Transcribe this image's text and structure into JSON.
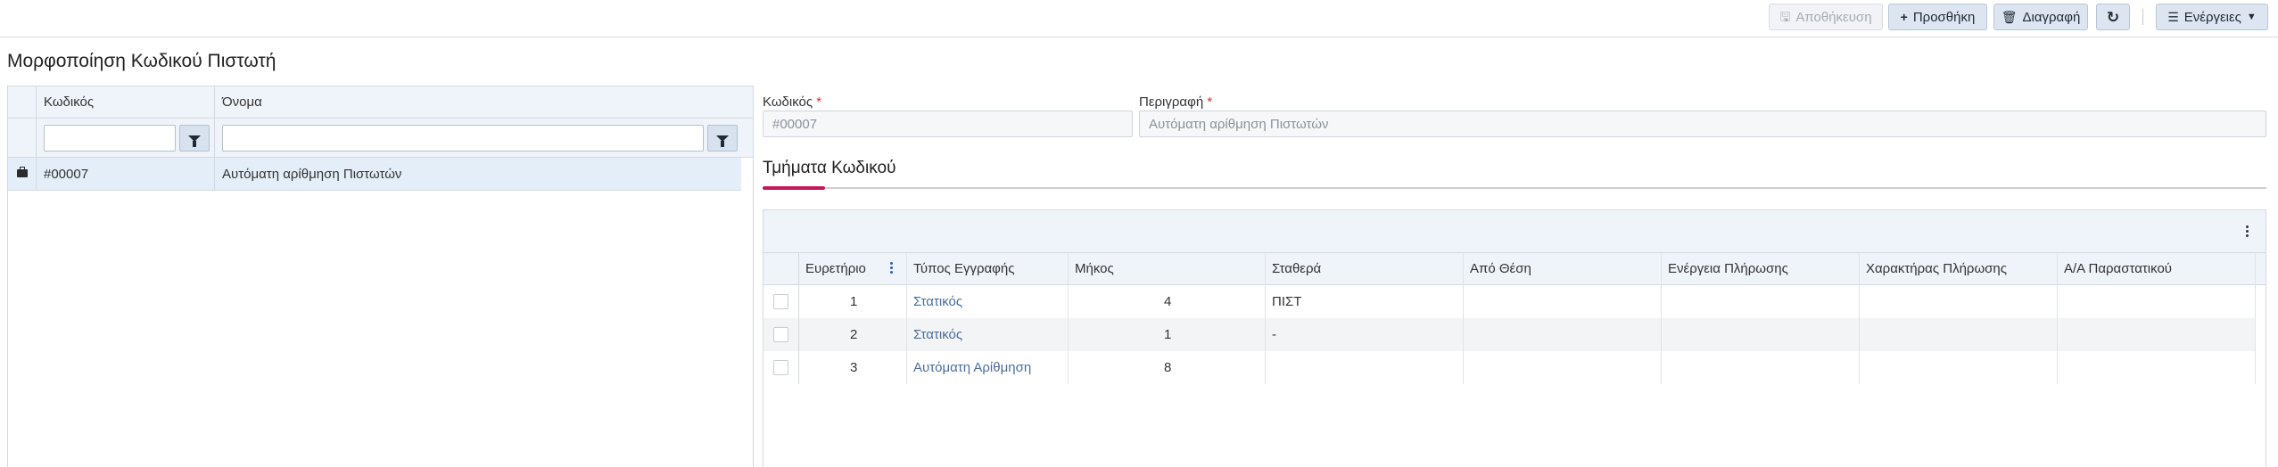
{
  "toolbar": {
    "save_label": "Αποθήκευση",
    "add_label": "Προσθήκη",
    "delete_label": "Διαγραφή",
    "actions_label": "Ενέργειες"
  },
  "page": {
    "title": "Μορφοποίηση Κωδικού Πιστωτή"
  },
  "left_grid": {
    "columns": [
      "Κωδικός",
      "Όνομα"
    ],
    "rows": [
      {
        "code": "#00007",
        "name": "Αυτόματη αρίθμηση Πιστωτών"
      }
    ]
  },
  "form": {
    "code_label": "Κωδικός",
    "code_value": "#00007",
    "description_label": "Περιγραφή",
    "description_value": "Αυτόματη αρίθμηση Πιστωτών",
    "required_mark": "*"
  },
  "section": {
    "title": "Τμήματα Κωδικού"
  },
  "segments_grid": {
    "columns": [
      "Ευρετήριο",
      "Τύπος Εγγραφής",
      "Μήκος",
      "Σταθερά",
      "Από Θέση",
      "Ενέργεια Πλήρωσης",
      "Χαρακτήρας Πλήρωσης",
      "Α/Α Παραστατικού"
    ],
    "rows": [
      {
        "index": "1",
        "type": "Στατικός",
        "length": "4",
        "constant": "ΠΙΣΤ"
      },
      {
        "index": "2",
        "type": "Στατικός",
        "length": "1",
        "constant": "-"
      },
      {
        "index": "3",
        "type": "Αυτόματη Αρίθμηση",
        "length": "8",
        "constant": ""
      }
    ]
  },
  "colors": {
    "accent": "#c2185b",
    "header_bg": "#eef4fa",
    "selected_row": "#e4eef9"
  }
}
